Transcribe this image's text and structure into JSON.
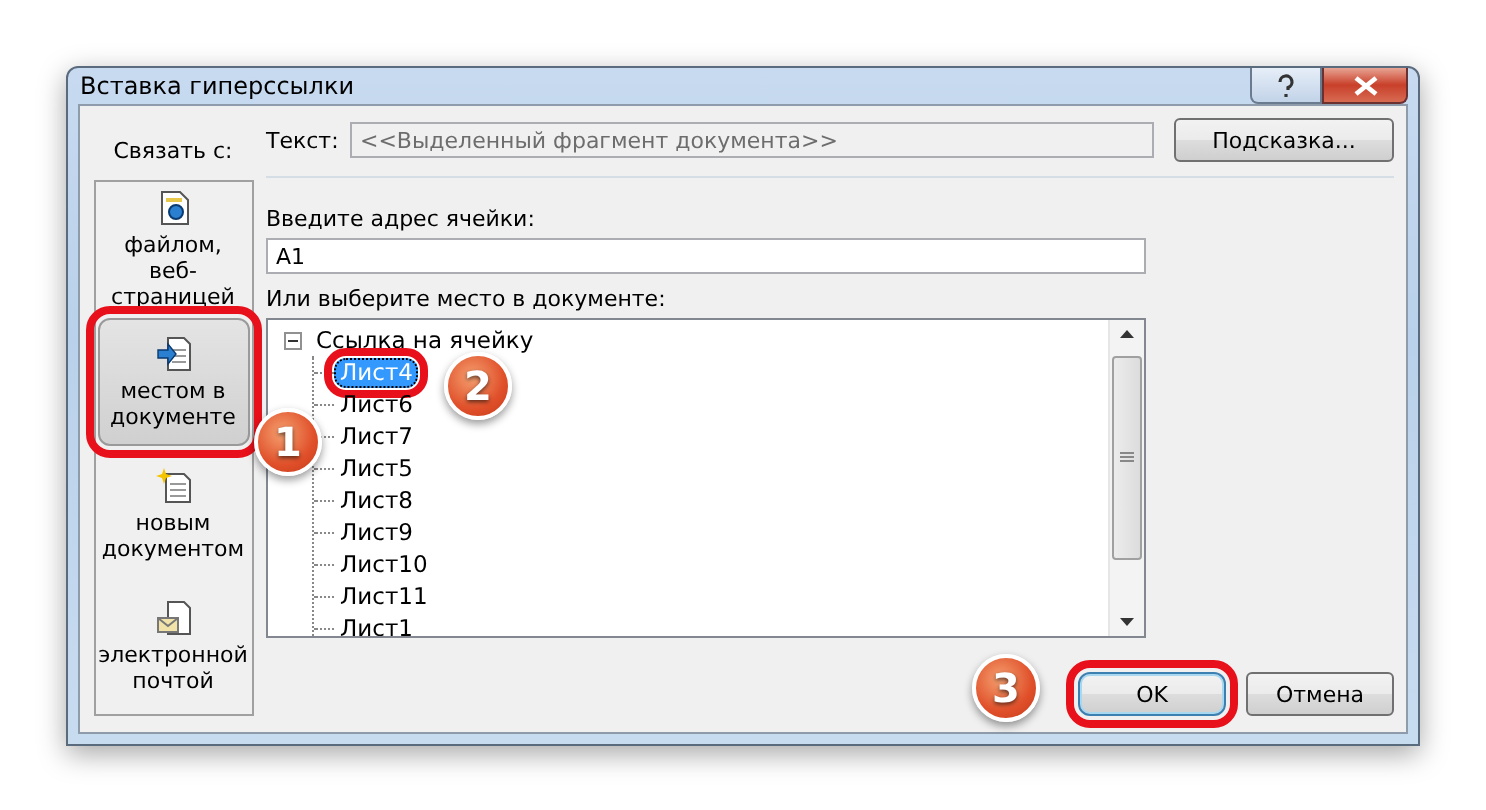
{
  "window": {
    "title": "Вставка гиперссылки"
  },
  "link_to": {
    "label": "Связать с:",
    "items": [
      {
        "label": "файлом, веб-страницей",
        "kind": "file",
        "selected": false,
        "highlighted": false
      },
      {
        "label": "местом в документе",
        "kind": "place",
        "selected": true,
        "highlighted": true
      },
      {
        "label": "новым документом",
        "kind": "new",
        "selected": false,
        "highlighted": false
      },
      {
        "label": "электронной почтой",
        "kind": "mail",
        "selected": false,
        "highlighted": false
      }
    ]
  },
  "text_field": {
    "label": "Текст:",
    "value": "<<Выделенный фрагмент документа>>"
  },
  "hint_button": "Подсказка...",
  "address_field": {
    "label": "Введите адрес ячейки:",
    "value": "A1"
  },
  "place_tree": {
    "label": "Или выберите место в документе:",
    "items": [
      {
        "label": "Ссылка на ячейку",
        "expanded": true,
        "selected": false,
        "children": [
          {
            "label": "Лист4",
            "selected": true,
            "highlighted": true
          },
          {
            "label": "Лист6",
            "selected": false,
            "highlighted": false
          },
          {
            "label": "Лист7",
            "selected": false,
            "highlighted": false
          },
          {
            "label": "Лист5",
            "selected": false,
            "highlighted": false
          },
          {
            "label": "Лист8",
            "selected": false,
            "highlighted": false
          },
          {
            "label": "Лист9",
            "selected": false,
            "highlighted": false
          },
          {
            "label": "Лист10",
            "selected": false,
            "highlighted": false
          },
          {
            "label": "Лист11",
            "selected": false,
            "highlighted": false
          },
          {
            "label": "Лист1",
            "selected": false,
            "highlighted": false
          }
        ]
      }
    ]
  },
  "buttons": [
    {
      "label": "OK",
      "default": true,
      "highlighted": true
    },
    {
      "label": "Отмена",
      "default": false,
      "highlighted": false
    }
  ],
  "annotations": [
    {
      "number": "1"
    },
    {
      "number": "2"
    },
    {
      "number": "3"
    }
  ]
}
